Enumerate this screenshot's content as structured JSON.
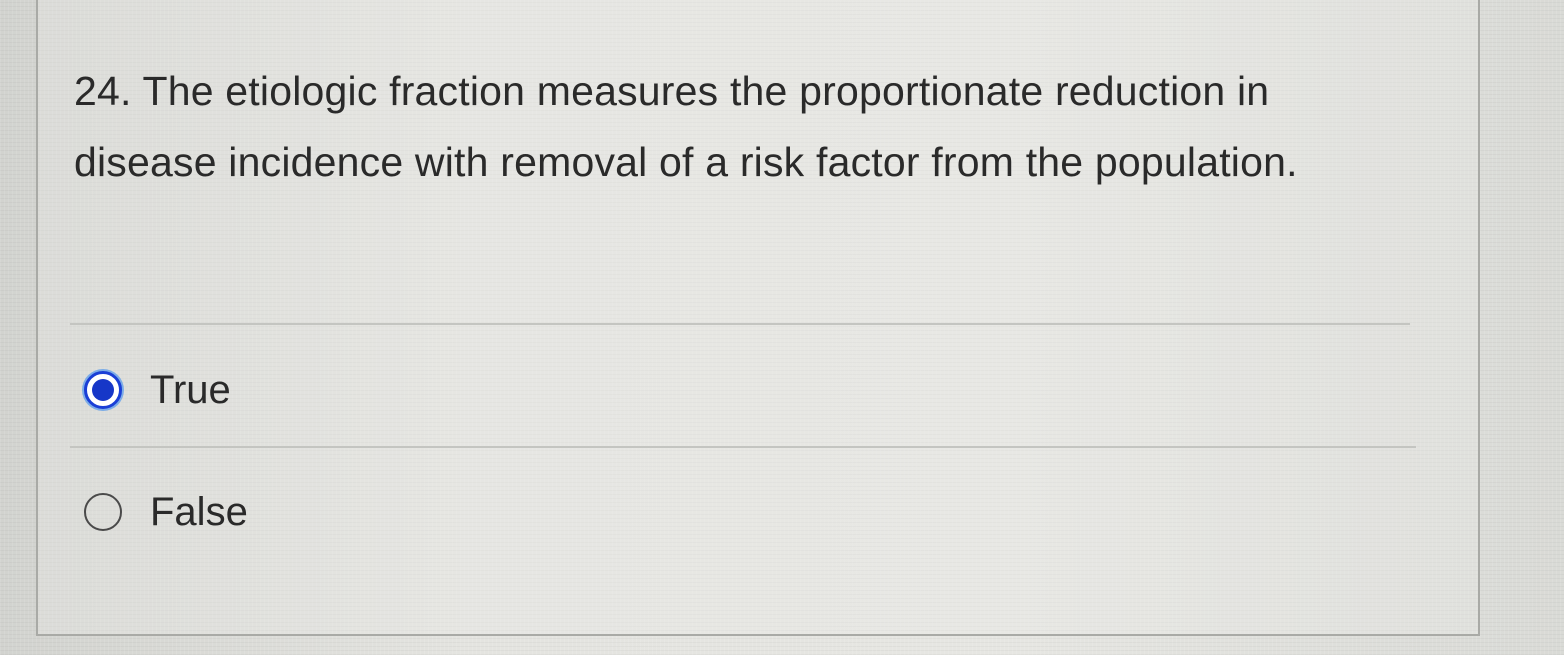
{
  "question": {
    "text": "24. The etiologic fraction measures the proportionate reduction in disease incidence with removal of a risk factor from the population."
  },
  "options": [
    {
      "label": "True",
      "selected": true
    },
    {
      "label": "False",
      "selected": false
    }
  ],
  "colors": {
    "accent": "#1637c8",
    "text": "#2a2a2a",
    "divider": "#c4c5c1",
    "border": "#a9aaa6"
  }
}
